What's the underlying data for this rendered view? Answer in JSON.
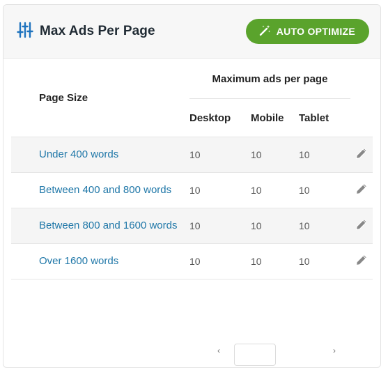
{
  "header": {
    "title": "Max Ads Per Page",
    "title_icon": "sliders-icon",
    "auto_optimize_label": "AUTO OPTIMIZE",
    "auto_optimize_icon": "magic-wand-icon"
  },
  "table": {
    "col_page_size": "Page Size",
    "group_header": "Maximum ads per page",
    "col_desktop": "Desktop",
    "col_mobile": "Mobile",
    "col_tablet": "Tablet",
    "rows": [
      {
        "label": "Under 400 words",
        "desktop": "10",
        "mobile": "10",
        "tablet": "10"
      },
      {
        "label": "Between 400 and 800 words",
        "desktop": "10",
        "mobile": "10",
        "tablet": "10"
      },
      {
        "label": "Between 800 and 1600 words",
        "desktop": "10",
        "mobile": "10",
        "tablet": "10"
      },
      {
        "label": "Over 1600 words",
        "desktop": "10",
        "mobile": "10",
        "tablet": "10"
      }
    ],
    "edit_icon": "pencil-icon"
  },
  "colors": {
    "accent_green": "#5aa32c",
    "link_blue": "#1f77a8",
    "icon_blue": "#1e73be"
  }
}
